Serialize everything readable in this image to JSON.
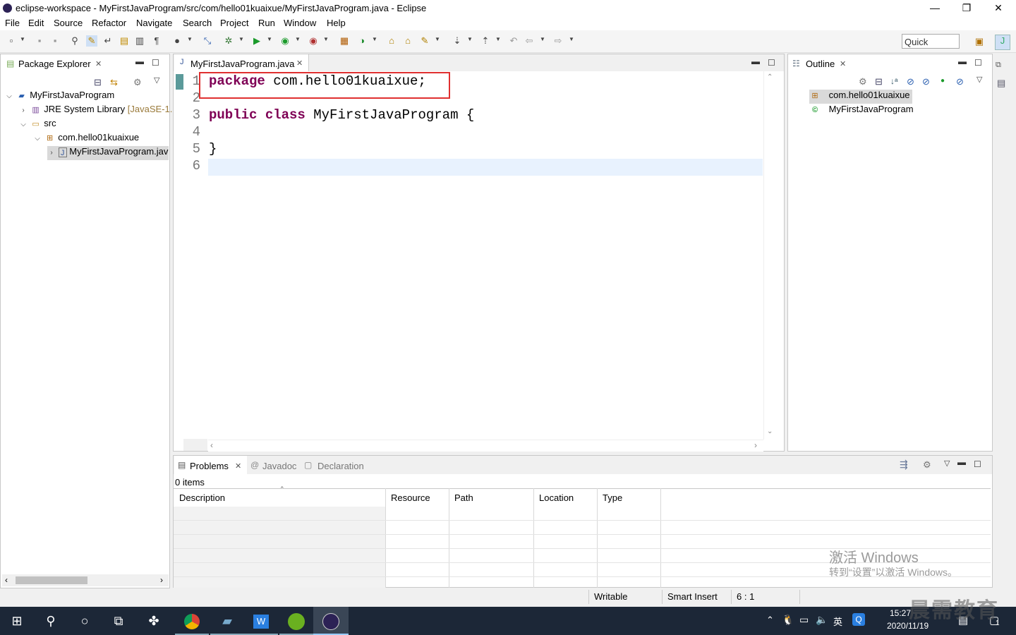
{
  "window": {
    "title": "eclipse-workspace - MyFirstJavaProgram/src/com/hello01kuaixue/MyFirstJavaProgram.java - Eclipse",
    "minimize": "—",
    "restore": "❐",
    "close": "✕"
  },
  "menu": [
    "File",
    "Edit",
    "Source",
    "Refactor",
    "Navigate",
    "Search",
    "Project",
    "Run",
    "Window",
    "Help"
  ],
  "toolbar": {
    "quick_access": "Quick Access"
  },
  "package_explorer": {
    "tab_label": "Package Explorer",
    "tree": {
      "project": "MyFirstJavaProgram",
      "jre": "JRE System Library",
      "jre_version": "[JavaSE-1.",
      "src": "src",
      "package": "com.hello01kuaixue",
      "file": "MyFirstJavaProgram.jav"
    }
  },
  "editor": {
    "tab_label": "MyFirstJavaProgram.java",
    "line_numbers": [
      "1",
      "2",
      "3",
      "4",
      "5",
      "6"
    ],
    "lines": {
      "l1_kw": "package",
      "l1_rest": " com.hello01kuaixue;",
      "l3_kw1": "public",
      "l3_kw2": "class",
      "l3_rest": " MyFirstJavaProgram {",
      "l5": "}"
    },
    "highlight_color": "#e03030"
  },
  "outline": {
    "tab_label": "Outline",
    "items": [
      "com.hello01kuaixue",
      "MyFirstJavaProgram"
    ]
  },
  "problems": {
    "tabs": [
      "Problems",
      "Javadoc",
      "Declaration"
    ],
    "count": "0 items",
    "columns": [
      "Description",
      "Resource",
      "Path",
      "Location",
      "Type"
    ]
  },
  "watermark": {
    "line1": "激活 Windows",
    "line2": "转到“设置”以激活 Windows。",
    "brand": "晨需教育"
  },
  "statusbar": {
    "writable": "Writable",
    "insert_mode": "Smart Insert",
    "position": "6 : 1"
  },
  "taskbar": {
    "time": "15:27",
    "date": "2020/11/19",
    "ime": "英",
    "notification_count": "1"
  }
}
